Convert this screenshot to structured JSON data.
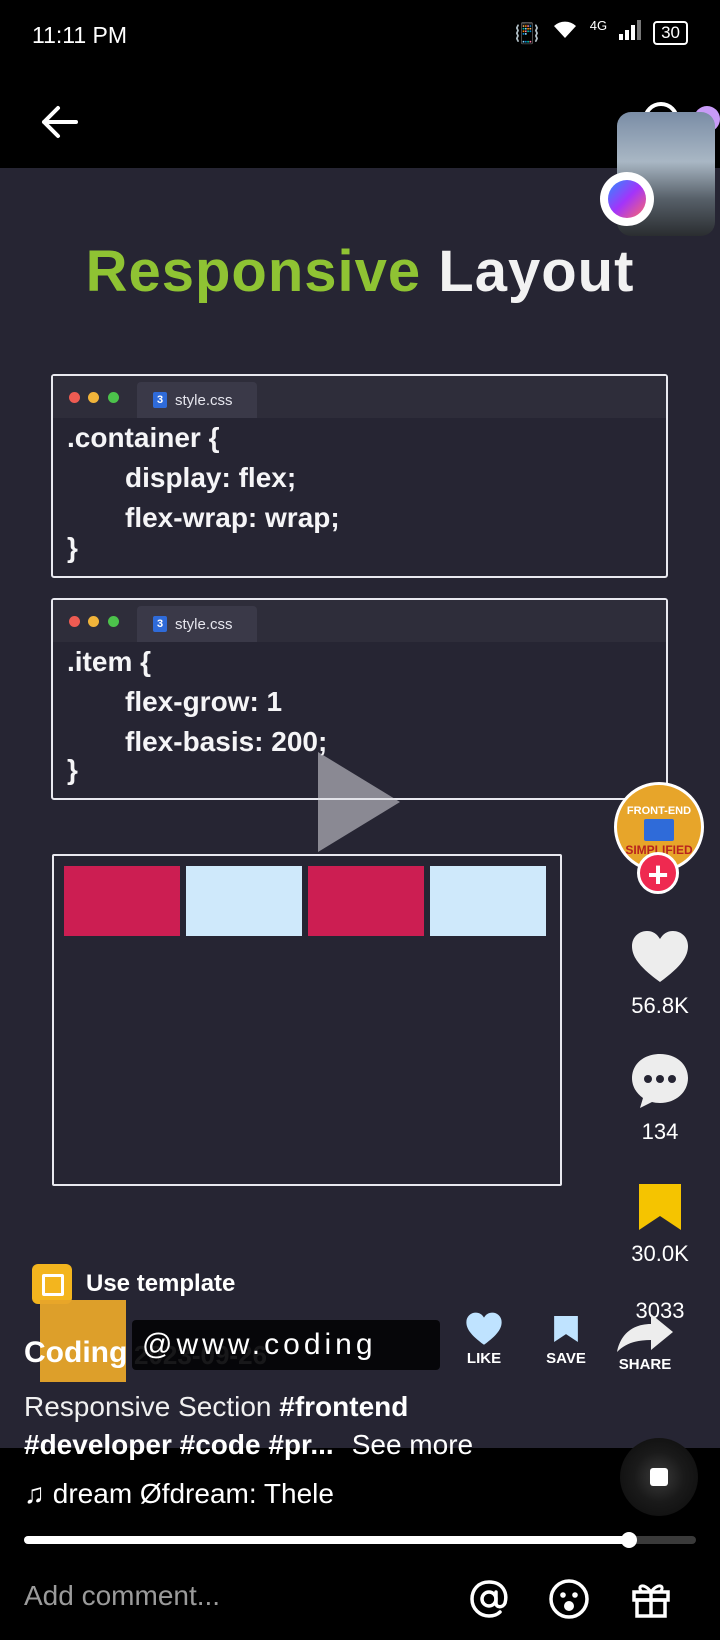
{
  "status_bar": {
    "time": "11:11 PM",
    "network": "4G",
    "battery": "30"
  },
  "video": {
    "title_part1": "Responsive",
    "title_part2": "Layout",
    "code_box_1": {
      "file_name": "style.css",
      "lines": [
        ".container {",
        "display: flex;",
        "flex-wrap: wrap;",
        "}"
      ]
    },
    "code_box_2": {
      "file_name": "style.css",
      "lines": [
        ".item {",
        "flex-grow: 1",
        "flex-basis: 200;",
        "}"
      ]
    },
    "demo_colors": [
      "#cc1e52",
      "#cfe9fb",
      "#cc1e52",
      "#cfe9fb"
    ]
  },
  "creator_badge": {
    "line1": "FRONT-END",
    "line3": "SIMPLIFIED"
  },
  "actions": {
    "like_count": "56.8K",
    "comment_count": "134",
    "save_count": "30.0K",
    "share_count": "3033"
  },
  "mini_actions": {
    "like_label": "LIKE",
    "save_label": "SAVE",
    "share_label": "SHARE"
  },
  "template": {
    "label": "Use template"
  },
  "author": {
    "name": "Coding",
    "date": "2023-09-26",
    "watermark": "@www.coding"
  },
  "caption": {
    "text": "Responsive Section",
    "hashtags_line1": "#frontend",
    "hashtags_line2": "#developer #code #pr...",
    "see_more": "See more"
  },
  "music": {
    "text": "♫ dream    Øfdream: Thele"
  },
  "progress": {
    "fraction": 0.9
  },
  "comment_bar": {
    "placeholder": "Add comment..."
  },
  "colors": {
    "accent_green": "#8fc333",
    "like_red": "#ef2950",
    "save_yellow": "#f5c400",
    "mini_blue": "#bfe3ff"
  }
}
